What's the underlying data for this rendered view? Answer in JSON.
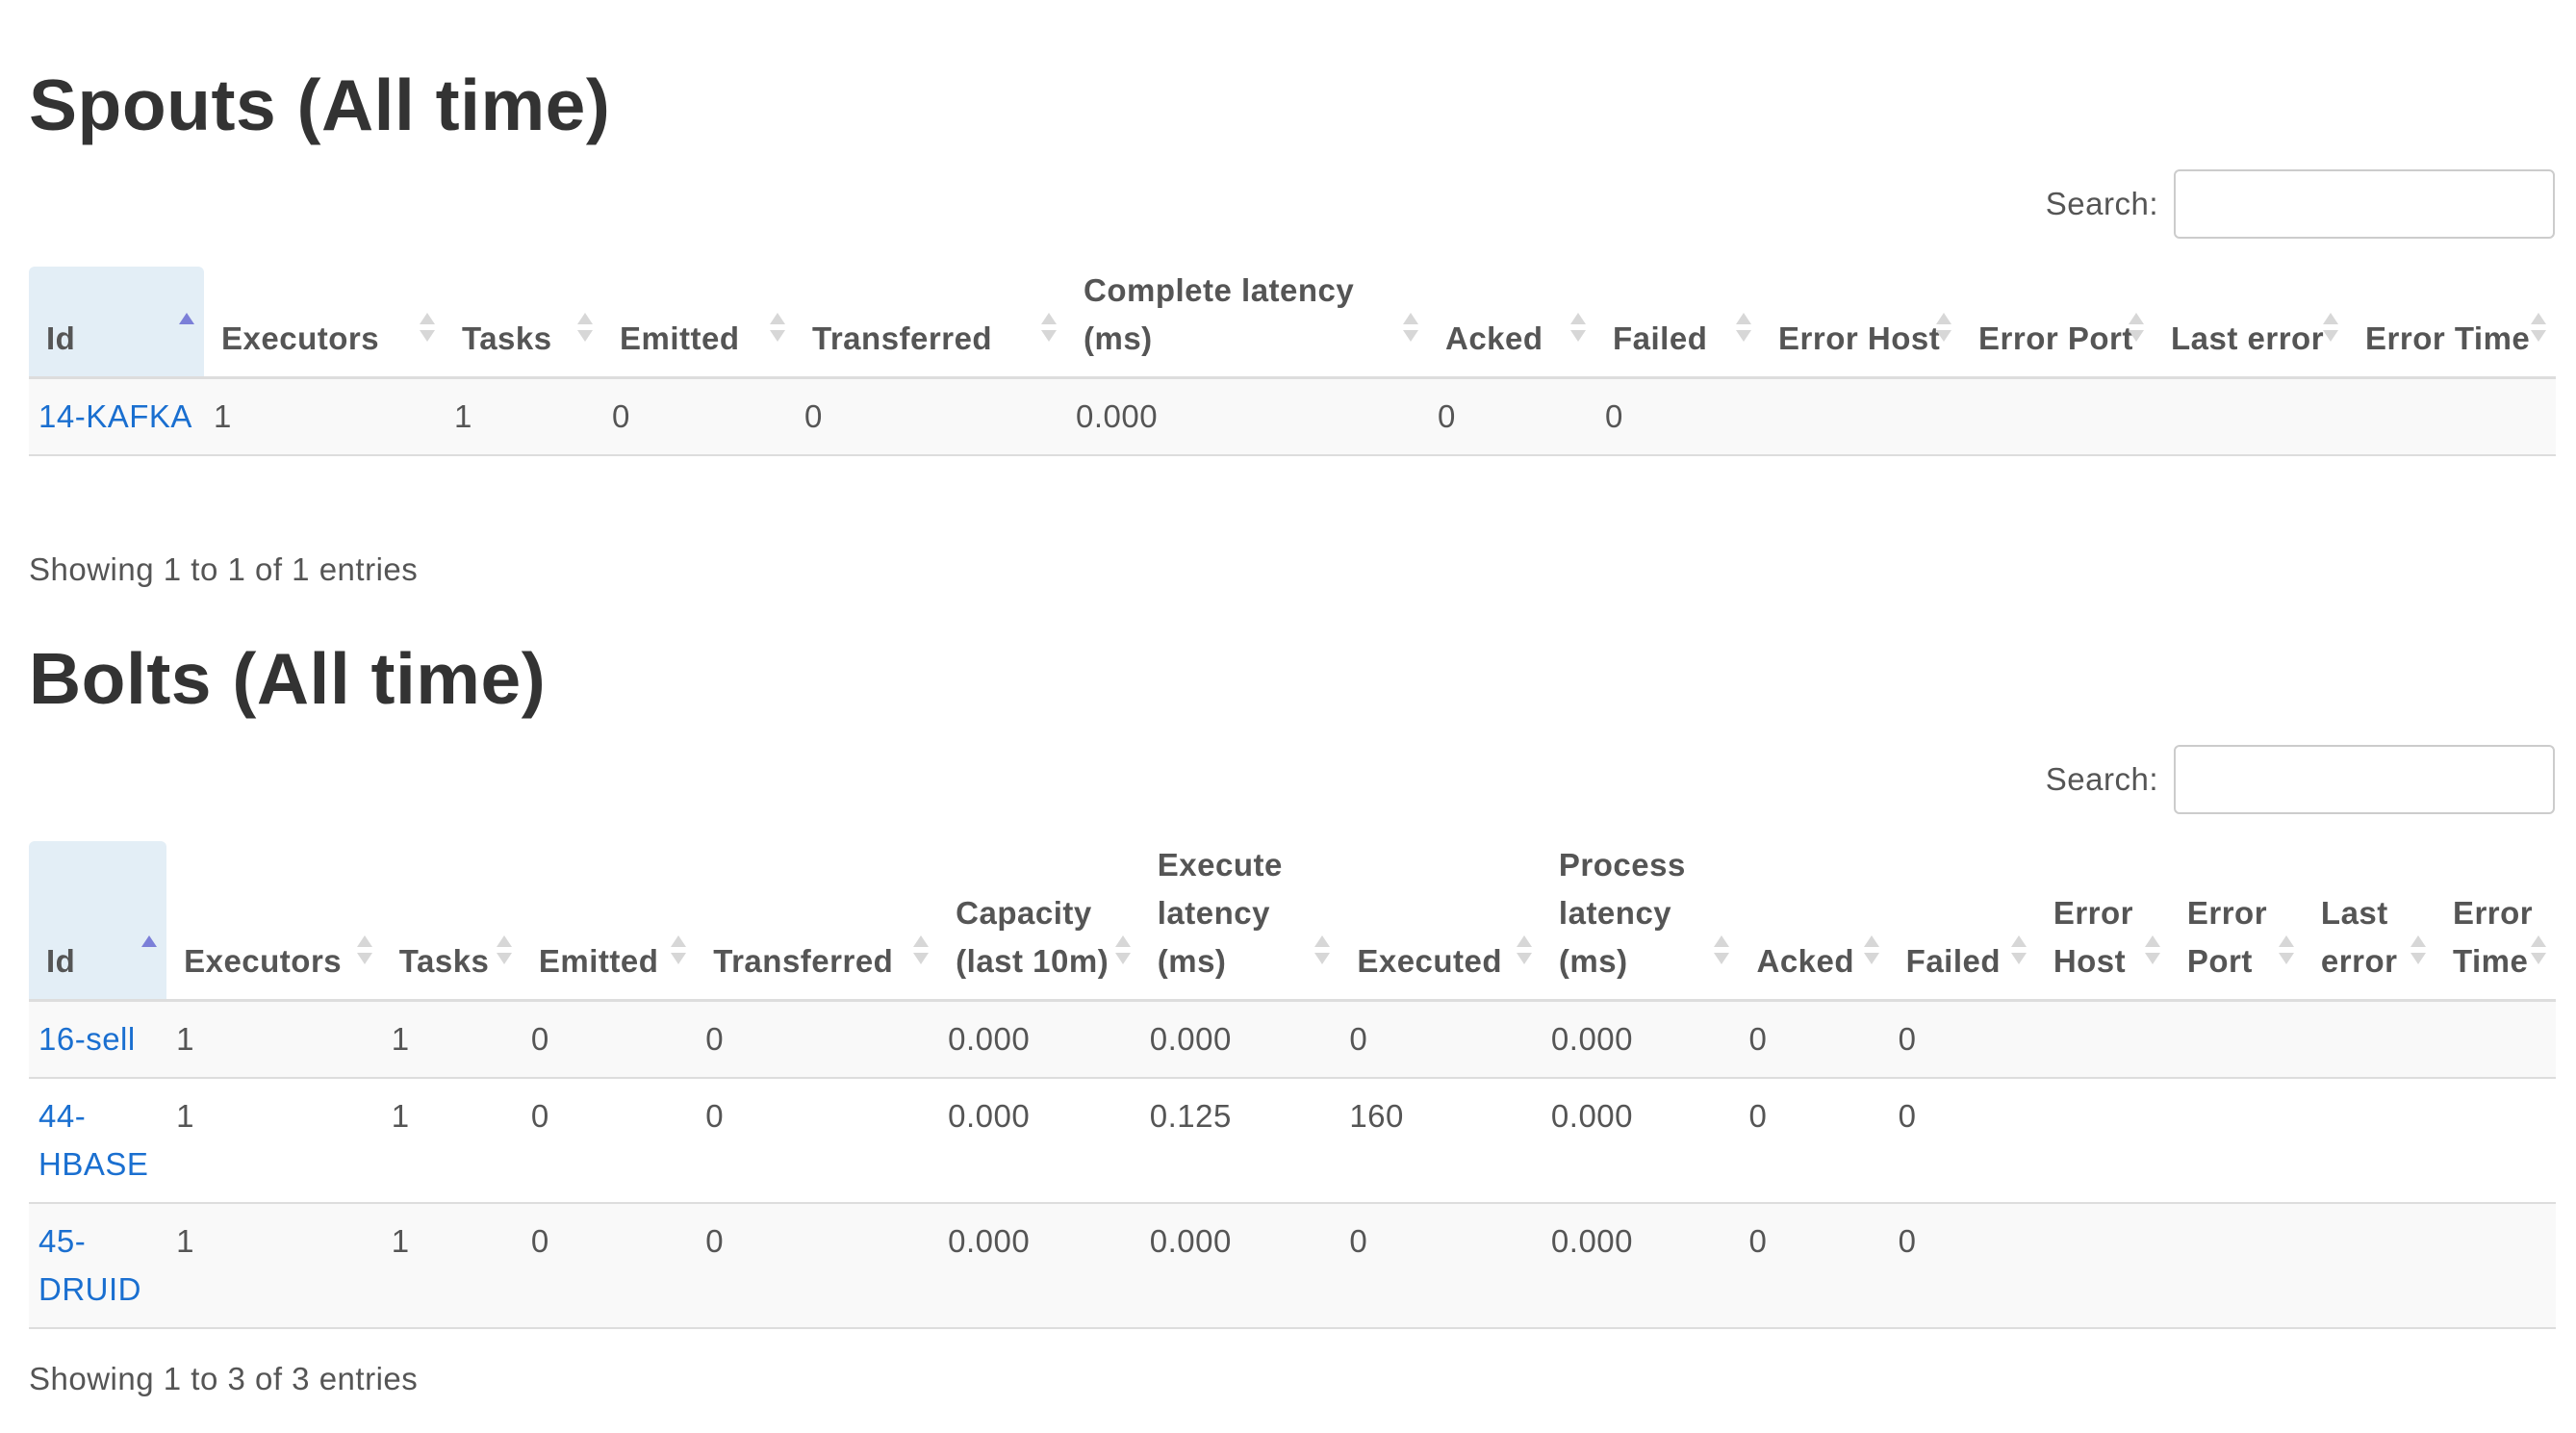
{
  "spouts": {
    "title": "Spouts (All time)",
    "search_label": "Search:",
    "search_value": "",
    "columns": [
      "Id",
      "Executors",
      "Tasks",
      "Emitted",
      "Transferred",
      "Complete latency (ms)",
      "Acked",
      "Failed",
      "Error Host",
      "Error Port",
      "Last error",
      "Error Time"
    ],
    "sorted_column": "Id",
    "sort_direction": "ascending",
    "rows": [
      {
        "id": "14-KAFKA",
        "executors": "1",
        "tasks": "1",
        "emitted": "0",
        "transferred": "0",
        "complete_latency": "0.000",
        "acked": "0",
        "failed": "0",
        "error_host": "",
        "error_port": "",
        "last_error": "",
        "error_time": ""
      }
    ],
    "info": "Showing 1 to 1 of 1 entries"
  },
  "bolts": {
    "title": "Bolts (All time)",
    "search_label": "Search:",
    "search_value": "",
    "columns": [
      "Id",
      "Executors",
      "Tasks",
      "Emitted",
      "Transferred",
      "Capacity (last 10m)",
      "Execute latency (ms)",
      "Executed",
      "Process latency (ms)",
      "Acked",
      "Failed",
      "Error Host",
      "Error Port",
      "Last error",
      "Error Time"
    ],
    "sorted_column": "Id",
    "sort_direction": "ascending",
    "rows": [
      {
        "id": "16-sell",
        "executors": "1",
        "tasks": "1",
        "emitted": "0",
        "transferred": "0",
        "capacity": "0.000",
        "execute_latency": "0.000",
        "executed": "0",
        "process_latency": "0.000",
        "acked": "0",
        "failed": "0",
        "error_host": "",
        "error_port": "",
        "last_error": "",
        "error_time": ""
      },
      {
        "id": "44-HBASE",
        "executors": "1",
        "tasks": "1",
        "emitted": "0",
        "transferred": "0",
        "capacity": "0.000",
        "execute_latency": "0.125",
        "executed": "160",
        "process_latency": "0.000",
        "acked": "0",
        "failed": "0",
        "error_host": "",
        "error_port": "",
        "last_error": "",
        "error_time": ""
      },
      {
        "id": "45-DRUID",
        "executors": "1",
        "tasks": "1",
        "emitted": "0",
        "transferred": "0",
        "capacity": "0.000",
        "execute_latency": "0.000",
        "executed": "0",
        "process_latency": "0.000",
        "acked": "0",
        "failed": "0",
        "error_host": "",
        "error_port": "",
        "last_error": "",
        "error_time": ""
      }
    ],
    "info": "Showing 1 to 3 of 3 entries"
  },
  "colors": {
    "link": "#1a6fd0",
    "sorted_header_bg": "#e3eef6",
    "sort_active": "#7b7fd8",
    "sort_inactive": "#d7d7d7",
    "row_stripe": "#f9f9f9"
  }
}
